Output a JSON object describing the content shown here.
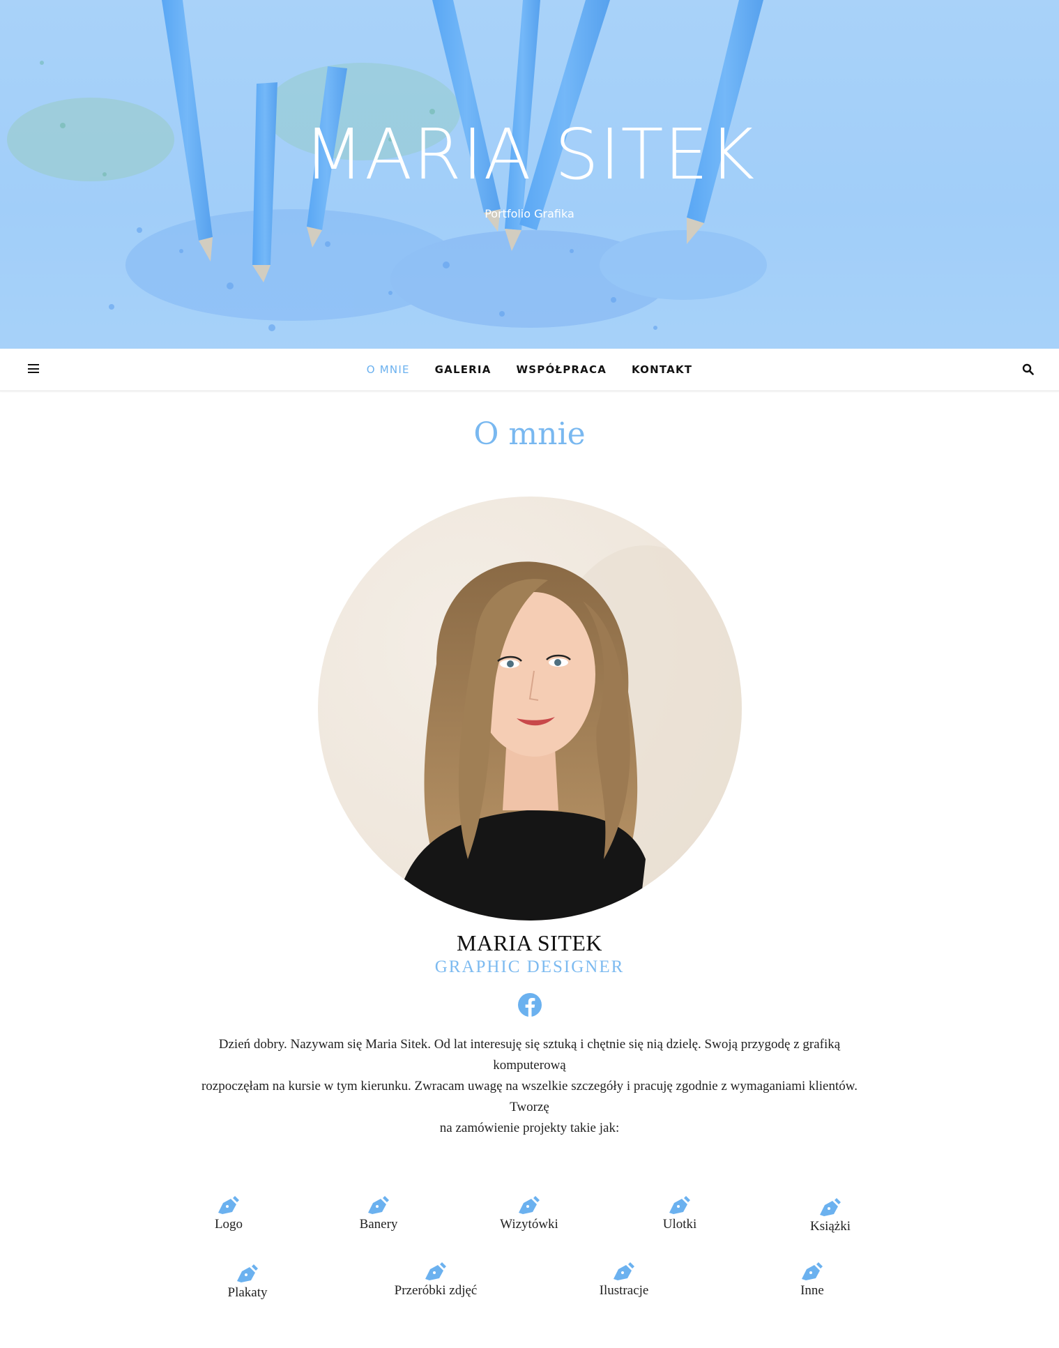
{
  "hero": {
    "title": "MARIA SITEK",
    "subtitle": "Portfolio Grafika"
  },
  "nav": {
    "items": [
      {
        "label": "O MNIE",
        "active": true
      },
      {
        "label": "GALERIA",
        "active": false
      },
      {
        "label": "WSPÓŁPRACA",
        "active": false
      },
      {
        "label": "KONTAKT",
        "active": false
      }
    ],
    "menu_icon": "hamburger-icon",
    "search_icon": "search-icon"
  },
  "main": {
    "page_title": "O mnie",
    "profile": {
      "name": "MARIA SITEK",
      "role": "GRAPHIC DESIGNER",
      "social_icon": "facebook-icon"
    },
    "intro_lines": [
      "Dzień dobry. Nazywam się Maria Sitek. Od lat interesuję się sztuką i chętnie się nią dzielę. Swoją przygodę z grafiką komputerową",
      "rozpoczęłam na kursie w tym kierunku. Zwracam uwagę na wszelkie szczegóły i pracuję zgodnie z wymaganiami klientów. Tworzę",
      "na zamówienie projekty takie jak:"
    ],
    "services": [
      "Logo",
      "Banery",
      "Wizytówki",
      "Ulotki",
      "Książki",
      "Plakaty",
      "Przeróbki zdjęć",
      "Ilustracje",
      "Inne"
    ],
    "service_icon": "pen-nib-icon"
  },
  "colors": {
    "accent": "#79b8f0",
    "hero_bg": "#a3cff8",
    "text": "#222222"
  }
}
